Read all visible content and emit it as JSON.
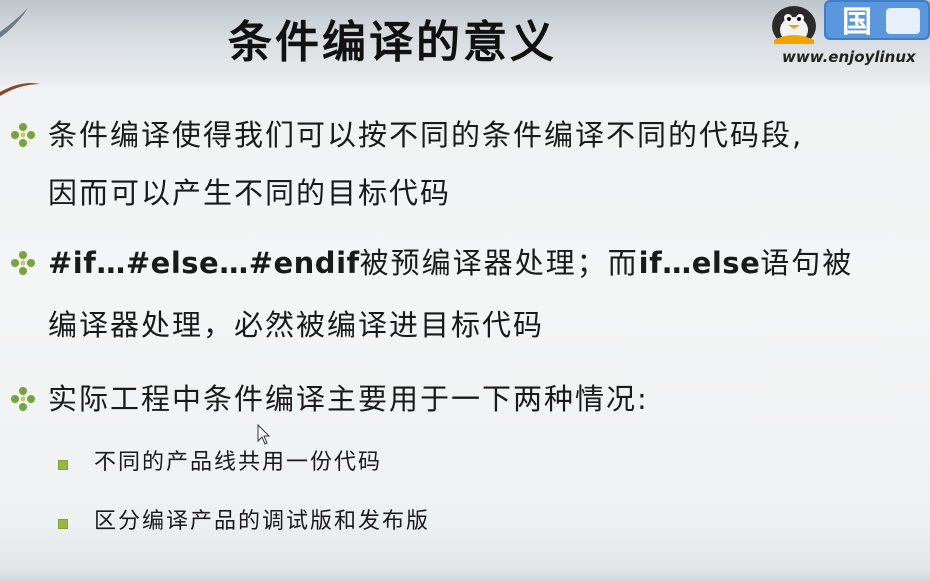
{
  "slide": {
    "title": "条件编译的意义",
    "site_url": "www.enjoylinux",
    "logo_text": "国",
    "bullets": [
      {
        "lines": [
          "条件编译使得我们可以按不同的条件编译不同的代码段,",
          "因而可以产生不同的目标代码"
        ]
      },
      {
        "line1": {
          "code1": "#if…#else…#endif",
          "text1": "被预编译器处理；而",
          "code2": "if…else",
          "text2": "语句被"
        },
        "line2": "编译器处理，必然被编译进目标代码"
      },
      {
        "lines": [
          "实际工程中条件编译主要用于一下两种情况:"
        ]
      }
    ],
    "sub_bullets": [
      "不同的产品线共用一份代码",
      "区分编译产品的调试版和发布版"
    ]
  },
  "colors": {
    "bullet_accent": "#7aa23a",
    "sub_marker": "#9bb545",
    "text": "#1a1a1a"
  },
  "icons": [
    "diamond-bullet-icon",
    "square-bullet-icon",
    "penguin-logo-icon",
    "mouse-cursor-icon"
  ]
}
